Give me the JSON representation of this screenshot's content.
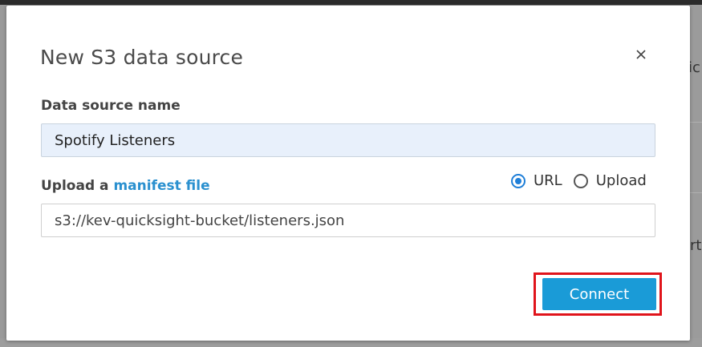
{
  "background": {
    "right_text_top": "ic",
    "right_text_mid": "rt"
  },
  "modal": {
    "title": "New S3 data source",
    "close_icon": "close-icon",
    "name_field": {
      "label": "Data source name",
      "value": "Spotify Listeners"
    },
    "upload_field": {
      "label_prefix": "Upload a ",
      "label_link": "manifest file",
      "value": "s3://kev-quicksight-bucket/listeners.json"
    },
    "source_options": [
      {
        "label": "URL",
        "selected": true
      },
      {
        "label": "Upload",
        "selected": false
      }
    ],
    "connect_label": "Connect"
  },
  "colors": {
    "accent": "#1a9bd7",
    "link": "#2a90cf",
    "highlight": "#e0141b",
    "input_fill": "#e8f0fb"
  }
}
